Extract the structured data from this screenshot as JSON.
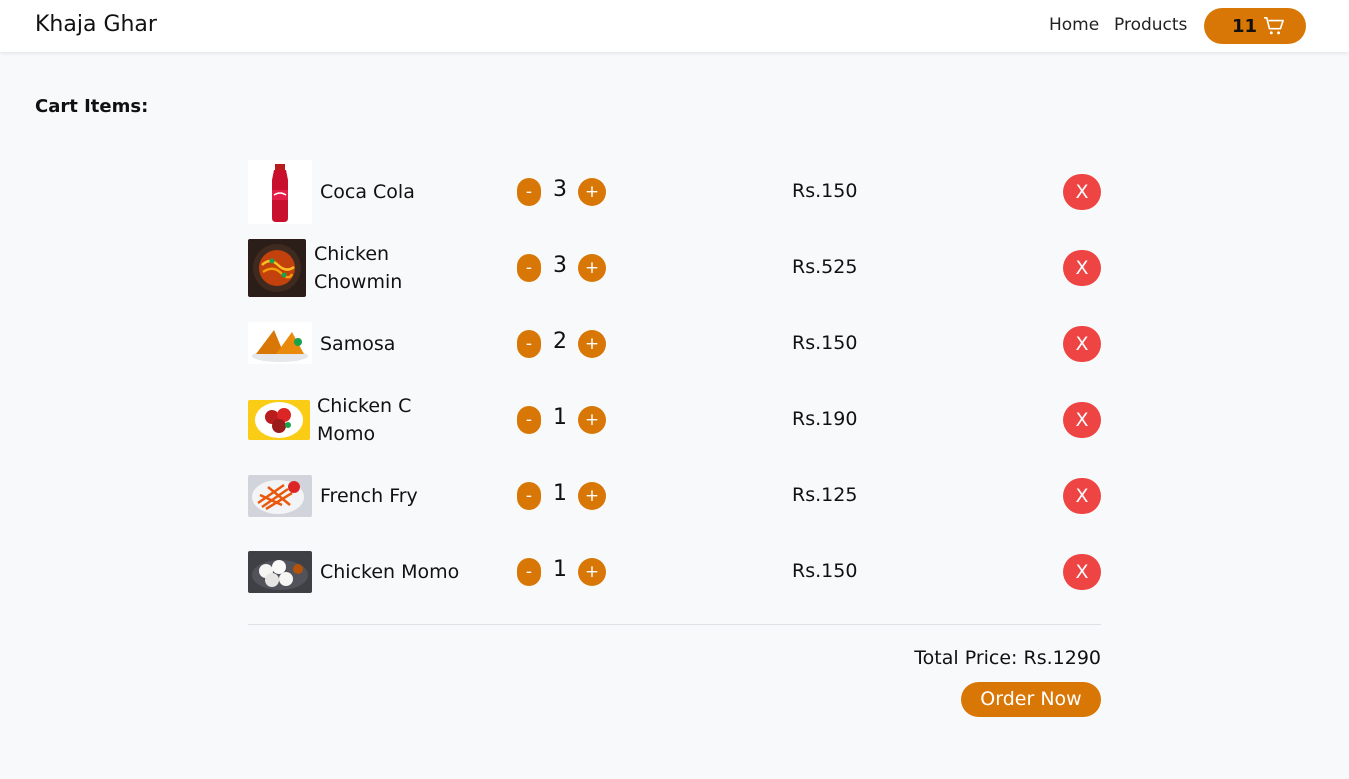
{
  "navbar": {
    "brand": "Khaja Ghar",
    "links": [
      "Home",
      "Products"
    ],
    "cart_count": "11",
    "cart_icon": "shopping-cart-icon"
  },
  "cart": {
    "title": "Cart Items:",
    "items": [
      {
        "name": "Coca Cola",
        "qty": "3",
        "price": "Rs.150",
        "remove": "X"
      },
      {
        "name": "Chicken Chowmin",
        "qty": "3",
        "price": "Rs.525",
        "remove": "X"
      },
      {
        "name": "Samosa",
        "qty": "2",
        "price": "Rs.150",
        "remove": "X"
      },
      {
        "name": "Chicken C Momo",
        "qty": "1",
        "price": "Rs.190",
        "remove": "X"
      },
      {
        "name": "French Fry",
        "qty": "1",
        "price": "Rs.125",
        "remove": "X"
      },
      {
        "name": "Chicken Momo",
        "qty": "1",
        "price": "Rs.150",
        "remove": "X"
      }
    ],
    "minus_label": "-",
    "plus_label": "+",
    "total": "Total Price: Rs.1290",
    "order_button": "Order Now"
  },
  "colors": {
    "accent": "#d97706",
    "danger": "#ef4444",
    "background": "#f8f9fb"
  }
}
